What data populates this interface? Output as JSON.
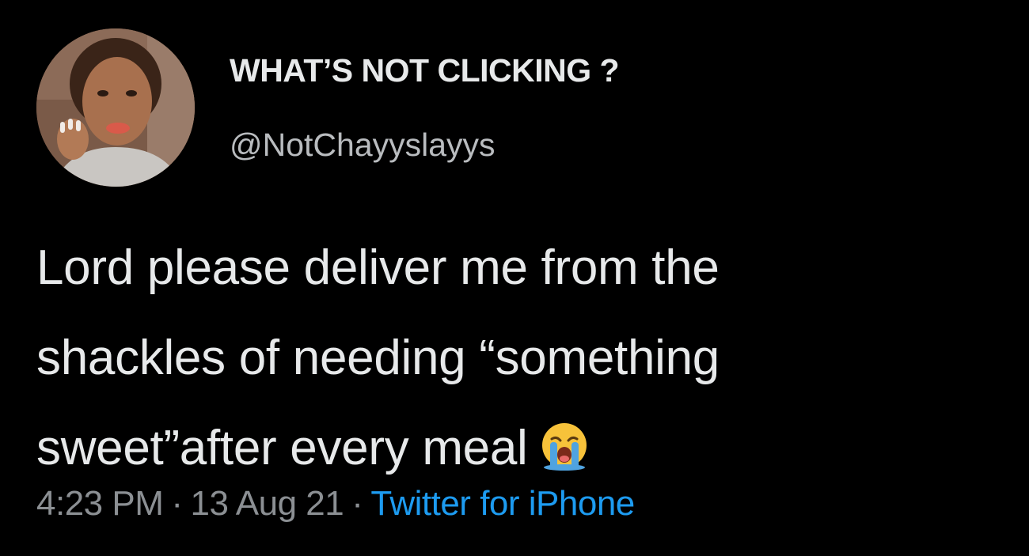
{
  "tweet": {
    "display_name": "WHAT’S NOT CLICKING ?",
    "handle": "@NotChayyslayys",
    "text_lines": [
      "Lord please deliver me from the",
      "shackles of needing “something",
      "sweet”after every meal"
    ],
    "emoji_icon": "loudly-crying-face-icon",
    "time": "4:23 PM",
    "separator": "·",
    "date": "13 Aug 21",
    "source": "Twitter for iPhone"
  },
  "colors": {
    "background": "#000000",
    "text": "#e7e9ea",
    "secondary_text": "#8b8f93",
    "link": "#1d9bf0"
  }
}
